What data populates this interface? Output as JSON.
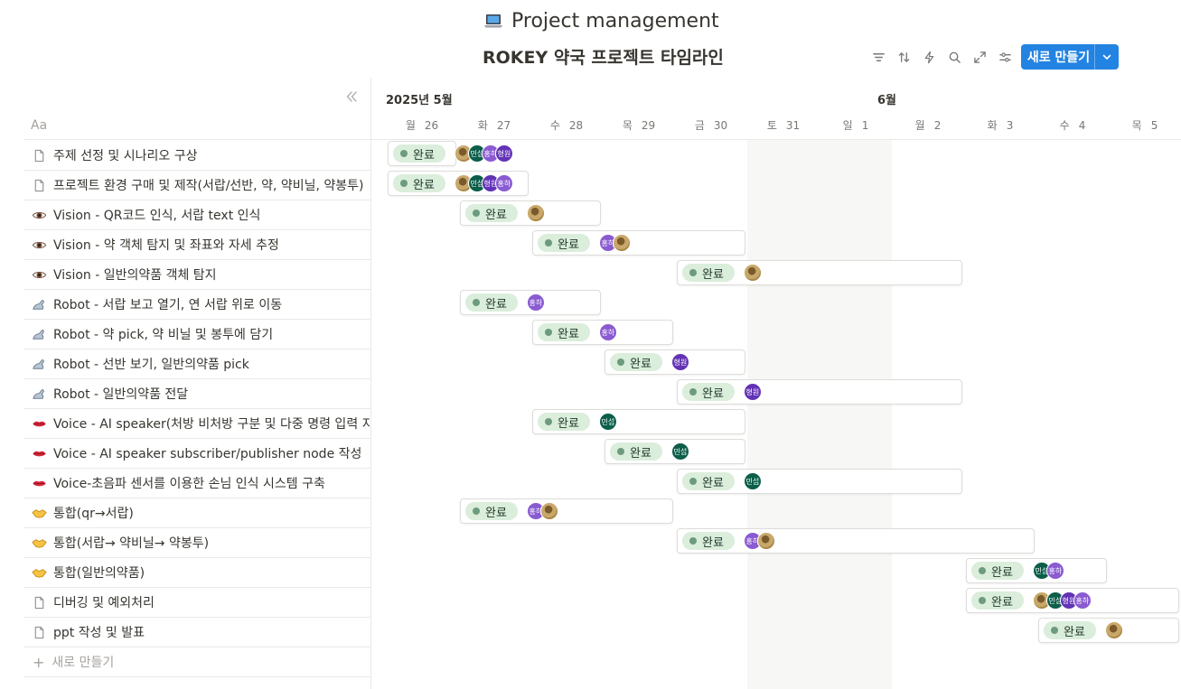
{
  "page": {
    "title": "Project management",
    "view_title": "ROKEY 약국 프로젝트 타임라인"
  },
  "toolbar": {
    "new_label": "새로 만들기"
  },
  "icons": {
    "page": "laptop-icon",
    "tools": [
      "filter-icon",
      "sort-icon",
      "automation-icon",
      "search-icon",
      "expand-icon",
      "settings-icon"
    ]
  },
  "table": {
    "header": "Aa",
    "new_row_label": "새로 만들기"
  },
  "timeline": {
    "months": [
      {
        "label": "2025년 5월"
      },
      {
        "label": "6월"
      }
    ],
    "days": [
      {
        "wd": "월",
        "d": "26"
      },
      {
        "wd": "화",
        "d": "27"
      },
      {
        "wd": "수",
        "d": "28"
      },
      {
        "wd": "목",
        "d": "29"
      },
      {
        "wd": "금",
        "d": "30"
      },
      {
        "wd": "토",
        "d": "31"
      },
      {
        "wd": "일",
        "d": "1"
      },
      {
        "wd": "월",
        "d": "2"
      },
      {
        "wd": "화",
        "d": "3"
      },
      {
        "wd": "수",
        "d": "4"
      },
      {
        "wd": "목",
        "d": "5"
      }
    ]
  },
  "status_label": "완료",
  "colors": {
    "accent": "#2383e2",
    "status_bg": "#dbeddb",
    "status_dot": "#6c9b7d",
    "민섭": "#0b5e4a",
    "홍하": "#8a5bd1",
    "형원": "#6233b5"
  },
  "tasks": [
    {
      "icon": "page-icon",
      "name": "주제 선정 및 시나리오 구상",
      "status": "완료",
      "start": 26,
      "span": 1,
      "assignees": [
        "img",
        "민섭",
        "홍하",
        "형원"
      ]
    },
    {
      "icon": "page-icon",
      "name": "프로젝트 환경 구매 및 제작(서랍/선반, 약, 약비닐, 약봉투)",
      "status": "완료",
      "start": 26,
      "span": 2,
      "assignees": [
        "img",
        "민섭",
        "형원",
        "홍하"
      ]
    },
    {
      "icon": "eye-icon",
      "name": "Vision - QR코드 인식, 서랍 text 인식",
      "status": "완료",
      "start": 27,
      "span": 2,
      "assignees": [
        "img"
      ]
    },
    {
      "icon": "eye-icon",
      "name": "Vision - 약 객체 탐지 및 좌표와 자세 추정",
      "status": "완료",
      "start": 28,
      "span": 3,
      "assignees": [
        "홍하",
        "img"
      ]
    },
    {
      "icon": "eye-icon",
      "name": "Vision - 일반의약품 객체 탐지",
      "status": "완료",
      "start": 30,
      "span": 4,
      "assignees": [
        "img"
      ]
    },
    {
      "icon": "robot-arm-icon",
      "name": "Robot - 서랍 보고 열기, 연 서랍 위로 이동",
      "status": "완료",
      "start": 27,
      "span": 2,
      "assignees": [
        "홍하"
      ]
    },
    {
      "icon": "robot-arm-icon",
      "name": "Robot - 약 pick, 약 비닐 및 봉투에 담기",
      "status": "완료",
      "start": 28,
      "span": 2,
      "assignees": [
        "홍하"
      ]
    },
    {
      "icon": "robot-arm-icon",
      "name": "Robot - 선반 보기, 일반의약품 pick",
      "status": "완료",
      "start": 29,
      "span": 2,
      "assignees": [
        "형원"
      ]
    },
    {
      "icon": "robot-arm-icon",
      "name": "Robot - 일반의약품 전달",
      "status": "완료",
      "start": 30,
      "span": 4,
      "assignees": [
        "형원"
      ]
    },
    {
      "icon": "lips-icon",
      "name": "Voice - AI speaker(처방 비처방 구분 및 다중 명령 입력 지원)",
      "status": "완료",
      "start": 28,
      "span": 3,
      "assignees": [
        "민섭"
      ]
    },
    {
      "icon": "lips-icon",
      "name": "Voice - AI speaker subscriber/publisher node 작성",
      "status": "완료",
      "start": 29,
      "span": 2,
      "assignees": [
        "민섭"
      ]
    },
    {
      "icon": "lips-icon",
      "name": "Voice-초음파 센서를 이용한 손님 인식 시스템 구축",
      "status": "완료",
      "start": 30,
      "span": 4,
      "assignees": [
        "민섭"
      ]
    },
    {
      "icon": "handshake-icon",
      "name": "통합(qr→서랍)",
      "status": "완료",
      "start": 27,
      "span": 3,
      "assignees": [
        "홍하",
        "img"
      ]
    },
    {
      "icon": "handshake-icon",
      "name": "통합(서랍→ 약비닐→ 약봉투)",
      "status": "완료",
      "start": 30,
      "span": 5,
      "assignees": [
        "홍하",
        "img"
      ]
    },
    {
      "icon": "handshake-icon",
      "name": "통합(일반의약품)",
      "status": "완료",
      "start": 34,
      "span": 2,
      "assignees": [
        "민섭",
        "홍하"
      ]
    },
    {
      "icon": "page-icon",
      "name": "디버깅 및 예외처리",
      "status": "완료",
      "start": 34,
      "span": 3,
      "assignees": [
        "img",
        "민섭",
        "형원",
        "홍하"
      ]
    },
    {
      "icon": "page-icon",
      "name": "ppt 작성 및 발표",
      "status": "완료",
      "start": 35,
      "span": 2,
      "assignees": [
        "img"
      ]
    }
  ]
}
